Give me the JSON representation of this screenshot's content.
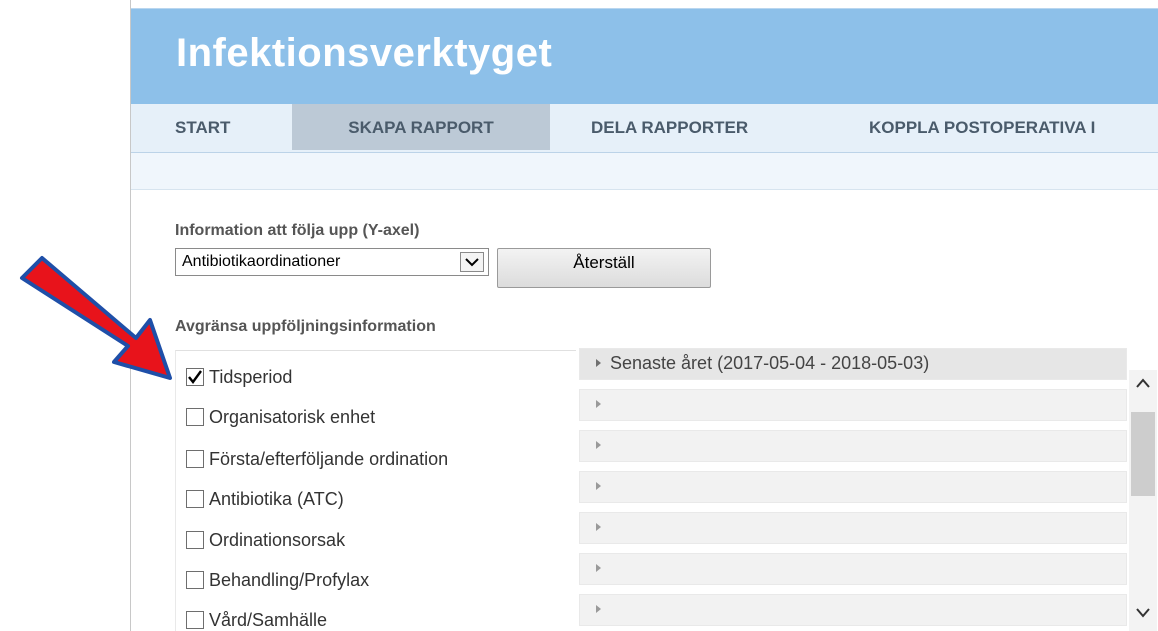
{
  "app": {
    "title": "Infektionsverktyget"
  },
  "nav": {
    "tabs": [
      {
        "label": "START"
      },
      {
        "label": "SKAPA RAPPORT",
        "active": true
      },
      {
        "label": "DELA RAPPORTER"
      },
      {
        "label": "KOPPLA POSTOPERATIVA I"
      }
    ]
  },
  "y_axis": {
    "label": "Information att följa upp (Y-axel)",
    "selected": "Antibiotikaordinationer",
    "reset_label": "Återställ"
  },
  "limit": {
    "label": "Avgränsa uppföljningsinformation",
    "items": [
      {
        "label": "Tidsperiod",
        "checked": true,
        "value": "Senaste året (2017-05-04 - 2018-05-03)"
      },
      {
        "label": "Organisatorisk enhet",
        "checked": false,
        "value": ""
      },
      {
        "label": "Första/efterföljande ordination",
        "checked": false,
        "value": ""
      },
      {
        "label": "Antibiotika (ATC)",
        "checked": false,
        "value": ""
      },
      {
        "label": "Ordinationsorsak",
        "checked": false,
        "value": ""
      },
      {
        "label": "Behandling/Profylax",
        "checked": false,
        "value": ""
      },
      {
        "label": "Vård/Samhälle",
        "checked": false,
        "value": ""
      }
    ]
  },
  "colors": {
    "header_bg": "#8dc0e9",
    "nav_bg": "#e6f0f9",
    "active_tab_bg": "#bcc9d6",
    "annotation_arrow": "#e8131b",
    "annotation_arrow_outline": "#1f4fa8"
  }
}
